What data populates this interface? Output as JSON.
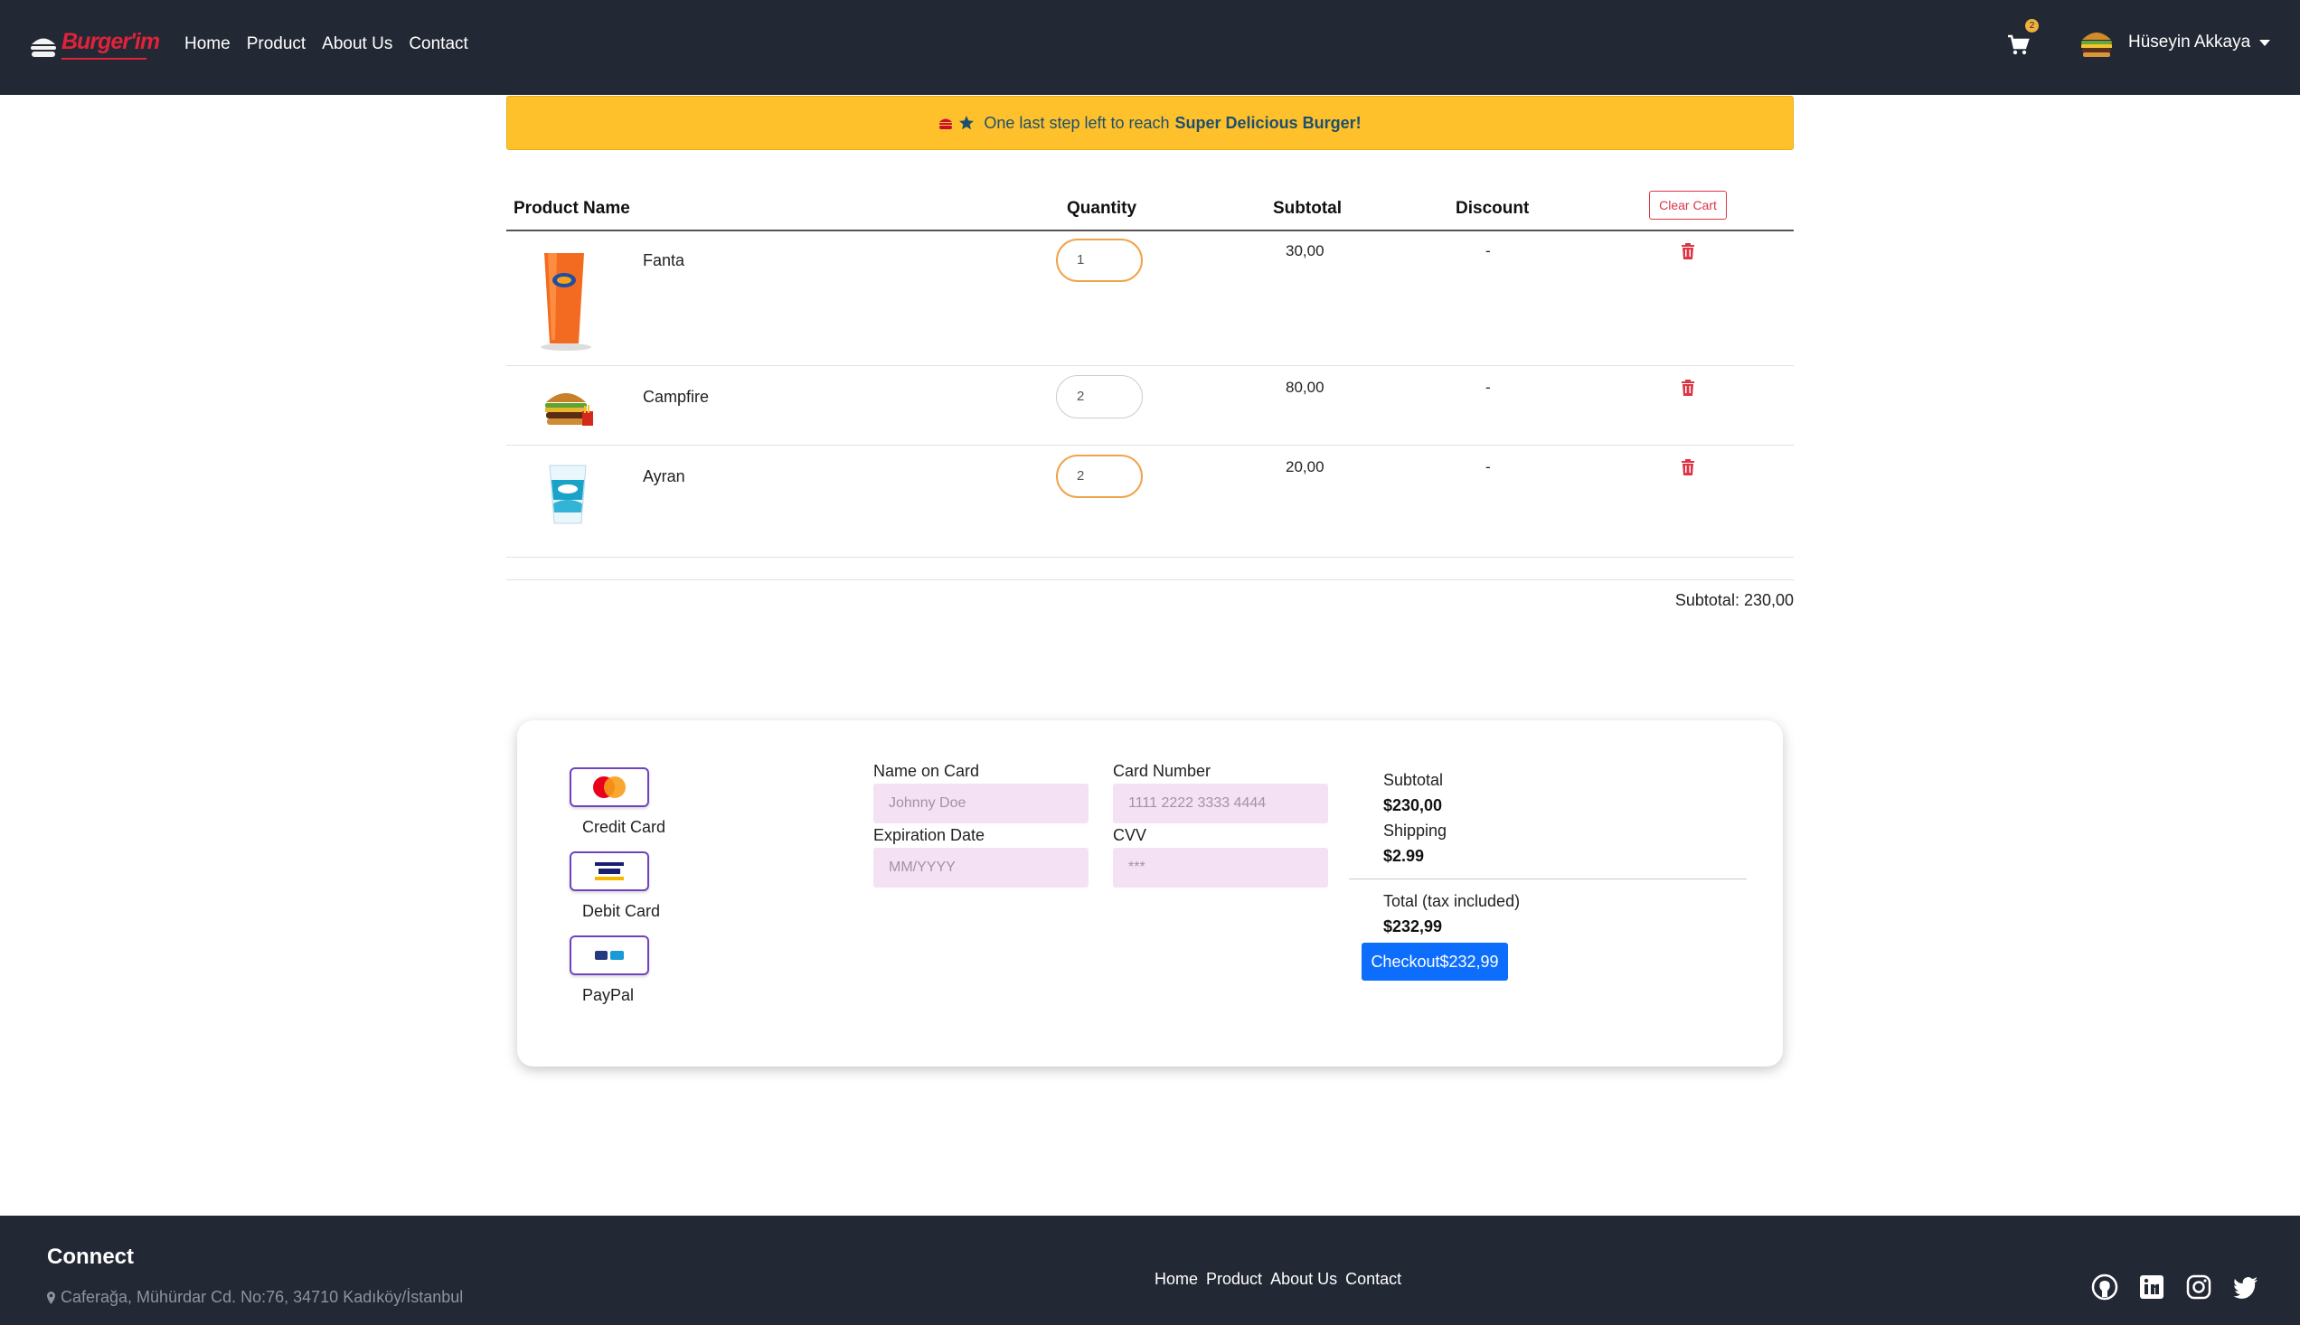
{
  "nav": {
    "brand": "Burger'im",
    "links": [
      "Home",
      "Product",
      "About Us",
      "Contact"
    ],
    "cart_count": "2",
    "user_name": "Hüseyin Akkaya"
  },
  "alert": {
    "text": "One last step left to reach",
    "highlight": "Super Delicious Burger!"
  },
  "cart": {
    "headers": {
      "product": "Product Name",
      "quantity": "Quantity",
      "subtotal": "Subtotal",
      "discount": "Discount"
    },
    "clear_label": "Clear Cart",
    "items": [
      {
        "name": "Fanta",
        "quantity": "1",
        "subtotal": "30,00",
        "discount": "-"
      },
      {
        "name": "Campfire",
        "quantity": "2",
        "subtotal": "80,00",
        "discount": "-"
      },
      {
        "name": "Ayran",
        "quantity": "2",
        "subtotal": "20,00",
        "discount": "-"
      }
    ],
    "subtotal_text": "Subtotal: 230,00"
  },
  "payment": {
    "methods": [
      "Credit Card",
      "Debit Card",
      "PayPal"
    ],
    "name_label": "Name on Card",
    "name_placeholder": "Johnny Doe",
    "card_label": "Card Number",
    "card_placeholder": "1111 2222 3333 4444",
    "exp_label": "Expiration Date",
    "exp_placeholder": "MM/YYYY",
    "cvv_label": "CVV",
    "cvv_placeholder": "***",
    "summary": {
      "subtotal_label": "Subtotal",
      "subtotal_value": "$230,00",
      "shipping_label": "Shipping",
      "shipping_value": "$2.99",
      "total_label": "Total (tax included)",
      "total_value": "$232,99"
    },
    "checkout_label": "Checkout$232,99"
  },
  "footer": {
    "title": "Connect",
    "address": "Caferağa, Mühürdar Cd. No:76, 34710 Kadıköy/İstanbul",
    "links": [
      "Home",
      "Product",
      "About Us",
      "Contact"
    ]
  },
  "colors": {
    "navbar": "#222834",
    "alert": "#ffc12b",
    "accent_red": "#dc3545",
    "checkout_blue": "#0d6efd",
    "field_bg": "#f4e1f4",
    "method_border": "#6f42c1"
  }
}
